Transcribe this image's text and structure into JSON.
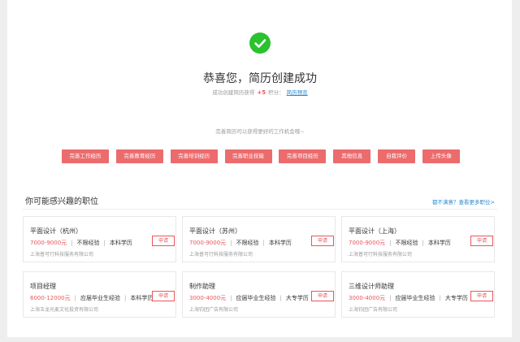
{
  "success": {
    "title": "恭喜您，简历创建成功",
    "points_prefix": "成功创建简历获得",
    "points_value": "+5",
    "points_suffix": "积分",
    "preview_link": "简历预览"
  },
  "hint": "完善简历可以获得更好的工作机会哦~",
  "actions": [
    "完善工作经历",
    "完善教育经历",
    "完善培训经历",
    "完善职业技能",
    "完善项目经历",
    "其他信息",
    "自我评价",
    "上传头像"
  ],
  "recommend": {
    "title": "你可能感兴趣的职位",
    "more_link": "都不满意？查看更多职位>",
    "apply_label": "申请",
    "jobs": [
      {
        "name": "平面设计（杭州）",
        "salary": "7000-9000元",
        "experience": "不限经验",
        "education": "本科学历",
        "company": "上海普可行科技服务有限公司"
      },
      {
        "name": "平面设计（苏州）",
        "salary": "7000-9000元",
        "experience": "不限经验",
        "education": "本科学历",
        "company": "上海普可行科技服务有限公司"
      },
      {
        "name": "平面设计（上海）",
        "salary": "7000-9000元",
        "experience": "不限经验",
        "education": "本科学历",
        "company": "上海普可行科技服务有限公司"
      },
      {
        "name": "项目经理",
        "salary": "6000-12000元",
        "experience": "应届毕业生经验",
        "education": "本科学历",
        "company": "上海玉龙光麦文化投资有限公司"
      },
      {
        "name": "制作助理",
        "salary": "3000-4000元",
        "experience": "应届毕业生经验",
        "education": "大专学历",
        "company": "上海钧团广告有限公司"
      },
      {
        "name": "三维设计师助理",
        "salary": "3000-4000元",
        "experience": "应届毕业生经验",
        "education": "大专学历",
        "company": "上海钧团广告有限公司"
      }
    ]
  },
  "colors": {
    "accent": "#e8565a",
    "button": "#ec6b6d",
    "success": "#2cc12f",
    "link": "#2a8ad1"
  },
  "icons": {
    "success": "check-circle-icon"
  }
}
